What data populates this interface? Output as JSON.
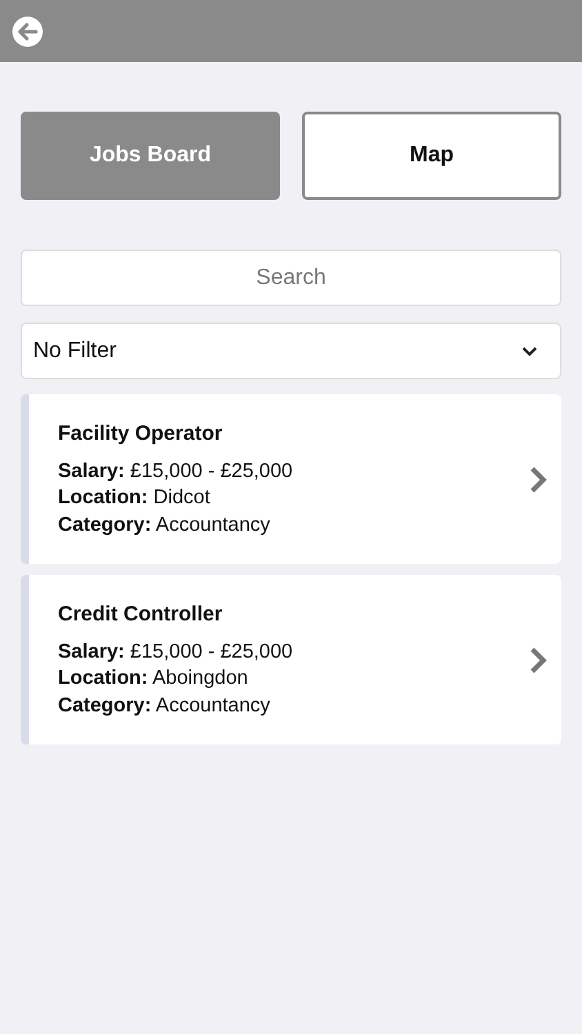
{
  "tabs": [
    {
      "label": "Jobs Board",
      "selected": true
    },
    {
      "label": "Map",
      "selected": false
    }
  ],
  "search": {
    "placeholder": "Search"
  },
  "filter": {
    "value": "No Filter"
  },
  "jobs": [
    {
      "title": "Facility Operator",
      "lines": [
        "**Salary:** £15,000 - £25,000",
        "**Location:** Didcot",
        "**Category:** Accountancy"
      ]
    },
    {
      "title": "Credit Controller",
      "lines": [
        "**Salary:** £15,000 - £25,000",
        "**Location:** Aboingdon",
        "**Category:** Accountancy"
      ]
    }
  ]
}
